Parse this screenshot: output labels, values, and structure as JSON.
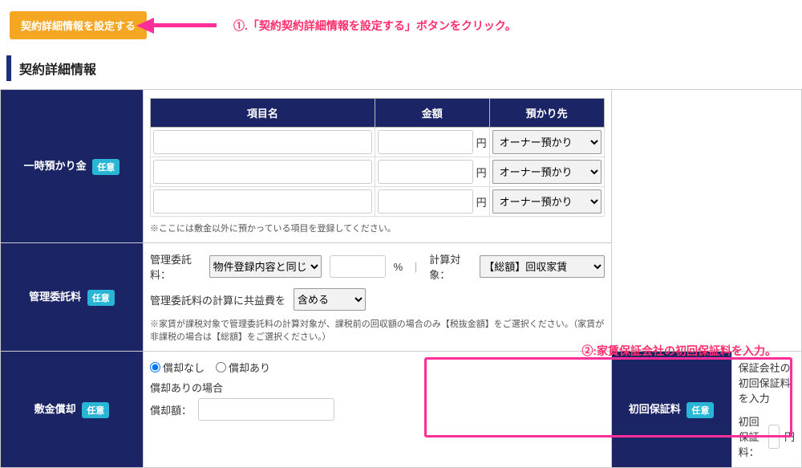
{
  "buttons": {
    "set_contract_detail": "契約詳細情報を設定する"
  },
  "instructions": {
    "i1": "①.「契約契約詳細情報を設定する」ボタンをクリック。",
    "i2": "②:家賃保証会社の初回保証料を入力。"
  },
  "section_title": "契約詳細情報",
  "badge": "任意",
  "deposit": {
    "label": "一時預かり金",
    "cols": {
      "item": "項目名",
      "amount": "金額",
      "dest": "預かり先"
    },
    "unit": "円",
    "dest_default": "オーナー預かり",
    "rows": 3,
    "note": "※ここには敷金以外に預かっている項目を登録してください。"
  },
  "mgmt": {
    "label": "管理委託料",
    "fee_label": "管理委託料：",
    "fee_select": "物件登録内容と同じ",
    "pct_unit": "%",
    "target_label": "計算対象：",
    "target_select": "【総額】回収家賃",
    "include_label": "管理委託料の計算に共益費を",
    "include_select": "含める",
    "note": "※家賃が課税対象で管理委託料の計算対象が、課税前の回収額の場合のみ【税抜金額】をご選択ください。（家賃が非課税の場合は【総額】をご選択ください。）"
  },
  "amort": {
    "label": "敷金償却",
    "radio_none": "償却なし",
    "radio_yes": "償却あり",
    "sub": "償却ありの場合",
    "amount_label": "償却額："
  },
  "first_fee": {
    "label": "初回保証料",
    "heading": "保証会社の初回保証料を入力",
    "field_label": "初回保証料：",
    "unit": "円"
  }
}
